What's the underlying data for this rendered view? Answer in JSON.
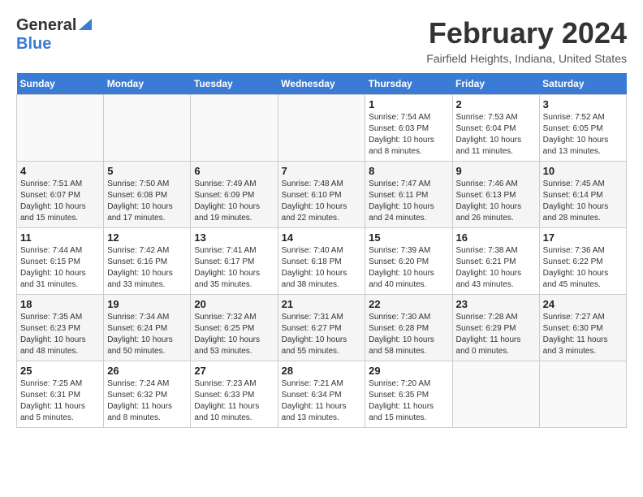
{
  "header": {
    "logo_general": "General",
    "logo_blue": "Blue",
    "month_year": "February 2024",
    "location": "Fairfield Heights, Indiana, United States"
  },
  "days_of_week": [
    "Sunday",
    "Monday",
    "Tuesday",
    "Wednesday",
    "Thursday",
    "Friday",
    "Saturday"
  ],
  "weeks": [
    [
      {
        "day": "",
        "detail": ""
      },
      {
        "day": "",
        "detail": ""
      },
      {
        "day": "",
        "detail": ""
      },
      {
        "day": "",
        "detail": ""
      },
      {
        "day": "1",
        "detail": "Sunrise: 7:54 AM\nSunset: 6:03 PM\nDaylight: 10 hours\nand 8 minutes."
      },
      {
        "day": "2",
        "detail": "Sunrise: 7:53 AM\nSunset: 6:04 PM\nDaylight: 10 hours\nand 11 minutes."
      },
      {
        "day": "3",
        "detail": "Sunrise: 7:52 AM\nSunset: 6:05 PM\nDaylight: 10 hours\nand 13 minutes."
      }
    ],
    [
      {
        "day": "4",
        "detail": "Sunrise: 7:51 AM\nSunset: 6:07 PM\nDaylight: 10 hours\nand 15 minutes."
      },
      {
        "day": "5",
        "detail": "Sunrise: 7:50 AM\nSunset: 6:08 PM\nDaylight: 10 hours\nand 17 minutes."
      },
      {
        "day": "6",
        "detail": "Sunrise: 7:49 AM\nSunset: 6:09 PM\nDaylight: 10 hours\nand 19 minutes."
      },
      {
        "day": "7",
        "detail": "Sunrise: 7:48 AM\nSunset: 6:10 PM\nDaylight: 10 hours\nand 22 minutes."
      },
      {
        "day": "8",
        "detail": "Sunrise: 7:47 AM\nSunset: 6:11 PM\nDaylight: 10 hours\nand 24 minutes."
      },
      {
        "day": "9",
        "detail": "Sunrise: 7:46 AM\nSunset: 6:13 PM\nDaylight: 10 hours\nand 26 minutes."
      },
      {
        "day": "10",
        "detail": "Sunrise: 7:45 AM\nSunset: 6:14 PM\nDaylight: 10 hours\nand 28 minutes."
      }
    ],
    [
      {
        "day": "11",
        "detail": "Sunrise: 7:44 AM\nSunset: 6:15 PM\nDaylight: 10 hours\nand 31 minutes."
      },
      {
        "day": "12",
        "detail": "Sunrise: 7:42 AM\nSunset: 6:16 PM\nDaylight: 10 hours\nand 33 minutes."
      },
      {
        "day": "13",
        "detail": "Sunrise: 7:41 AM\nSunset: 6:17 PM\nDaylight: 10 hours\nand 35 minutes."
      },
      {
        "day": "14",
        "detail": "Sunrise: 7:40 AM\nSunset: 6:18 PM\nDaylight: 10 hours\nand 38 minutes."
      },
      {
        "day": "15",
        "detail": "Sunrise: 7:39 AM\nSunset: 6:20 PM\nDaylight: 10 hours\nand 40 minutes."
      },
      {
        "day": "16",
        "detail": "Sunrise: 7:38 AM\nSunset: 6:21 PM\nDaylight: 10 hours\nand 43 minutes."
      },
      {
        "day": "17",
        "detail": "Sunrise: 7:36 AM\nSunset: 6:22 PM\nDaylight: 10 hours\nand 45 minutes."
      }
    ],
    [
      {
        "day": "18",
        "detail": "Sunrise: 7:35 AM\nSunset: 6:23 PM\nDaylight: 10 hours\nand 48 minutes."
      },
      {
        "day": "19",
        "detail": "Sunrise: 7:34 AM\nSunset: 6:24 PM\nDaylight: 10 hours\nand 50 minutes."
      },
      {
        "day": "20",
        "detail": "Sunrise: 7:32 AM\nSunset: 6:25 PM\nDaylight: 10 hours\nand 53 minutes."
      },
      {
        "day": "21",
        "detail": "Sunrise: 7:31 AM\nSunset: 6:27 PM\nDaylight: 10 hours\nand 55 minutes."
      },
      {
        "day": "22",
        "detail": "Sunrise: 7:30 AM\nSunset: 6:28 PM\nDaylight: 10 hours\nand 58 minutes."
      },
      {
        "day": "23",
        "detail": "Sunrise: 7:28 AM\nSunset: 6:29 PM\nDaylight: 11 hours\nand 0 minutes."
      },
      {
        "day": "24",
        "detail": "Sunrise: 7:27 AM\nSunset: 6:30 PM\nDaylight: 11 hours\nand 3 minutes."
      }
    ],
    [
      {
        "day": "25",
        "detail": "Sunrise: 7:25 AM\nSunset: 6:31 PM\nDaylight: 11 hours\nand 5 minutes."
      },
      {
        "day": "26",
        "detail": "Sunrise: 7:24 AM\nSunset: 6:32 PM\nDaylight: 11 hours\nand 8 minutes."
      },
      {
        "day": "27",
        "detail": "Sunrise: 7:23 AM\nSunset: 6:33 PM\nDaylight: 11 hours\nand 10 minutes."
      },
      {
        "day": "28",
        "detail": "Sunrise: 7:21 AM\nSunset: 6:34 PM\nDaylight: 11 hours\nand 13 minutes."
      },
      {
        "day": "29",
        "detail": "Sunrise: 7:20 AM\nSunset: 6:35 PM\nDaylight: 11 hours\nand 15 minutes."
      },
      {
        "day": "",
        "detail": ""
      },
      {
        "day": "",
        "detail": ""
      }
    ]
  ]
}
